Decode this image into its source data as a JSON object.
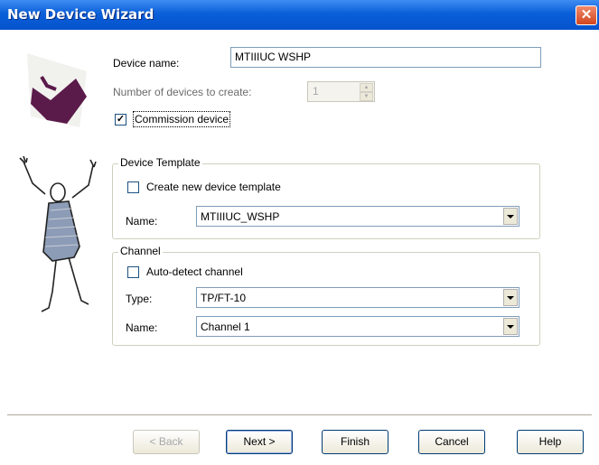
{
  "window": {
    "title": "New Device Wizard",
    "close_symbol": "✕"
  },
  "fields": {
    "device_name": {
      "label": "Device name:",
      "value": "MTIIIUC WSHP"
    },
    "number_of_devices": {
      "label": "Number of devices to create:",
      "value": "1"
    },
    "commission_device": {
      "label": "Commission device",
      "checked": true,
      "check_mark": "✓"
    }
  },
  "device_template": {
    "title": "Device Template",
    "create_new": {
      "label": "Create new device template",
      "checked": false
    },
    "name_label": "Name:",
    "name_value": "MTIIIUC_WSHP"
  },
  "channel": {
    "title": "Channel",
    "auto_detect": {
      "label": "Auto-detect channel",
      "checked": false
    },
    "type_label": "Type:",
    "type_value": "TP/FT-10",
    "name_label": "Name:",
    "name_value": "Channel 1"
  },
  "buttons": {
    "back": "< Back",
    "next": "Next >",
    "finish": "Finish",
    "cancel": "Cancel",
    "help": "Help"
  },
  "colors": {
    "titlebar": "#0a5fd8",
    "close": "#d2461f",
    "brand_purple": "#5a1a4a"
  }
}
